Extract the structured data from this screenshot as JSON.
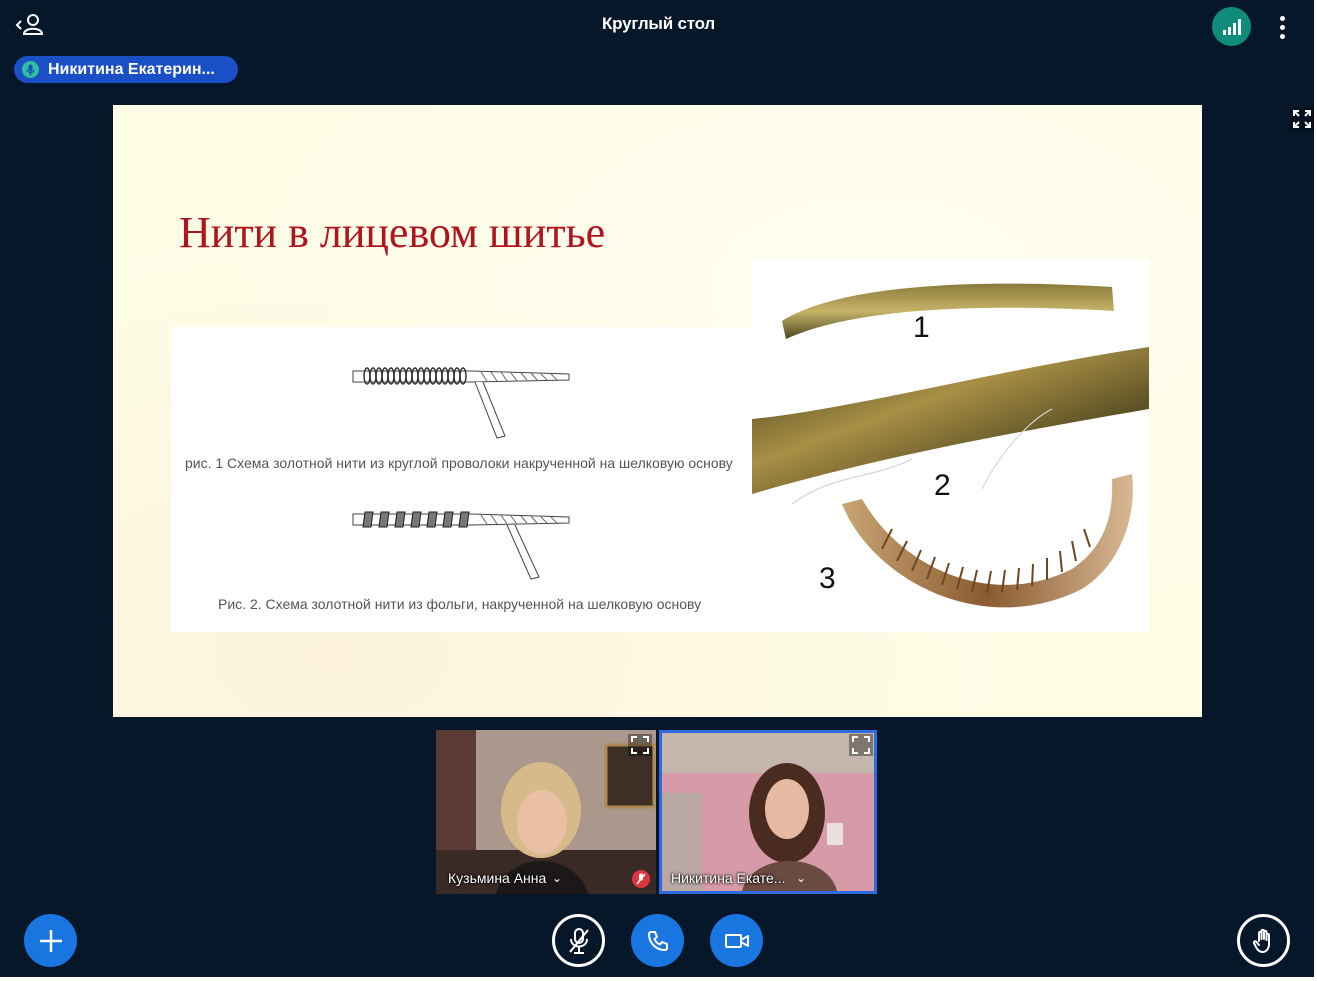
{
  "header": {
    "title": "Круглый стол",
    "talking_indicator": "Никитина Екатерин..."
  },
  "slide": {
    "title": "Нити в лицевом шитье",
    "caption_1": "рис. 1 Схема золотной нити из круглой проволоки накрученной на шелковую основу",
    "caption_2": "Рис. 2. Схема золотной нити из фольги, накрученной на шелковую основу",
    "photo_labels": [
      "1",
      "2",
      "3"
    ]
  },
  "videos": [
    {
      "name": "Кузьмина Анна",
      "muted": true
    },
    {
      "name": "Никитина Екате...",
      "muted": false
    }
  ],
  "icons": {
    "users": "users-icon",
    "connection": "connection-bars-icon",
    "options": "more-vertical-icon",
    "fullscreen": "fullscreen-icon",
    "actions": "plus-icon",
    "mic": "mic-muted-icon",
    "audio": "phone-icon",
    "camera": "camera-icon",
    "raise_hand": "hand-icon"
  },
  "colors": {
    "background": "#06172a",
    "primary": "#1976e0",
    "connection": "#0f8c7a",
    "talking": "#1b4fc5",
    "slide_title": "#b0141c"
  }
}
